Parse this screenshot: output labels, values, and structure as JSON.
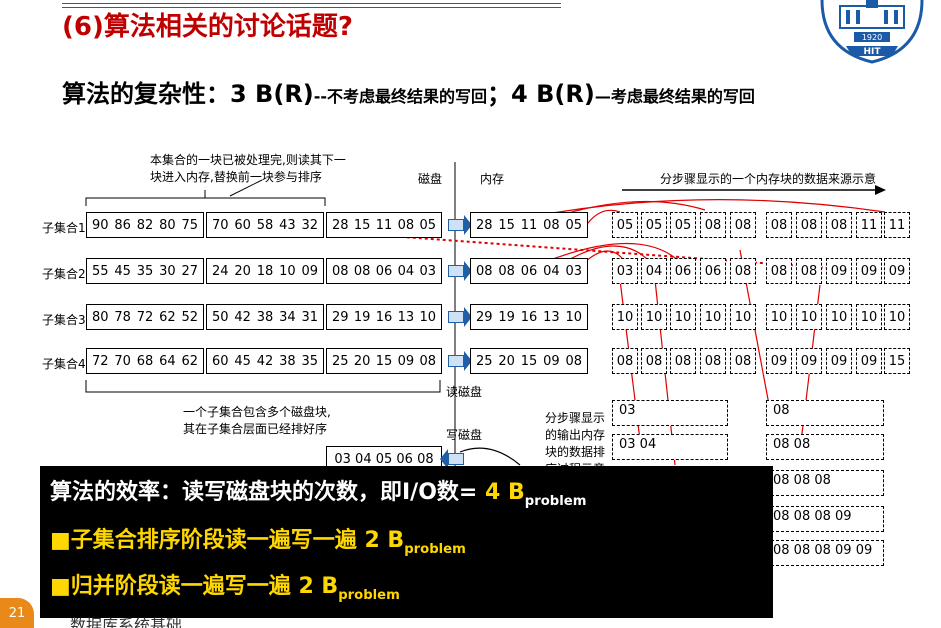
{
  "title": "(6)算法相关的讨论话题?",
  "subtitle": {
    "prefix": "算法的复杂性：3 B(R)",
    "note1": "--不考虑最终结果的写回",
    "mid": "；4 B(R)",
    "note2": "—考虑最终结果的写回"
  },
  "logo": {
    "year": "1920",
    "text": "HIT"
  },
  "diagram": {
    "note_top": [
      "本集合的一块已被处理完,则读其下一",
      "块进入内存,替换前一块参与排序"
    ],
    "label_disk": "磁盘",
    "label_mem": "内存",
    "label_steps": "分步骤显示的一个内存块的数据来源示意",
    "rows": [
      {
        "label": "子集合1",
        "b1": [
          "90",
          "86",
          "82",
          "80",
          "75"
        ],
        "b2": [
          "70",
          "60",
          "58",
          "43",
          "32"
        ],
        "b3": [
          "28",
          "15",
          "11",
          "08",
          "05"
        ],
        "mem": [
          "28",
          "15",
          "11",
          "08",
          "05"
        ],
        "steps": [
          "05",
          "05",
          "05",
          "08",
          "08",
          "08",
          "08",
          "08",
          "11",
          "11"
        ]
      },
      {
        "label": "子集合2",
        "b1": [
          "55",
          "45",
          "35",
          "30",
          "27"
        ],
        "b2": [
          "24",
          "20",
          "18",
          "10",
          "09"
        ],
        "b3": [
          "08",
          "08",
          "06",
          "04",
          "03"
        ],
        "mem": [
          "08",
          "08",
          "06",
          "04",
          "03"
        ],
        "steps": [
          "03",
          "04",
          "06",
          "06",
          "08",
          "08",
          "08",
          "09",
          "09",
          "09"
        ]
      },
      {
        "label": "子集合3",
        "b1": [
          "80",
          "78",
          "72",
          "62",
          "52"
        ],
        "b2": [
          "50",
          "42",
          "38",
          "34",
          "31"
        ],
        "b3": [
          "29",
          "19",
          "16",
          "13",
          "10"
        ],
        "mem": [
          "29",
          "19",
          "16",
          "13",
          "10"
        ],
        "steps": [
          "10",
          "10",
          "10",
          "10",
          "10",
          "10",
          "10",
          "10",
          "10",
          "10"
        ]
      },
      {
        "label": "子集合4",
        "b1": [
          "72",
          "70",
          "68",
          "64",
          "62"
        ],
        "b2": [
          "60",
          "45",
          "42",
          "38",
          "35"
        ],
        "b3": [
          "25",
          "20",
          "15",
          "09",
          "08"
        ],
        "mem": [
          "25",
          "20",
          "15",
          "09",
          "08"
        ],
        "steps": [
          "08",
          "08",
          "08",
          "08",
          "08",
          "09",
          "09",
          "09",
          "09",
          "15"
        ]
      }
    ],
    "label_read_disk": "读磁盘",
    "label_write_disk": "写磁盘",
    "note_bottom": [
      "一个子集合包含多个磁盘块,",
      "其在子集合层面已经排好序"
    ],
    "note_output": [
      "分步骤显示",
      "的输出内存",
      "块的数据排",
      "序过程示意"
    ],
    "write_block": "03 04 05 06 08",
    "output_left": [
      "03",
      "03  04"
    ],
    "output_right": [
      "08",
      "08  08",
      "08  08  08",
      "08  08  08  09",
      "08  08  08  09  09"
    ]
  },
  "overlay": {
    "line1_prefix": "算法的效率：读写磁盘块的次数，即I/O数=",
    "line1_value": "4 B",
    "line1_sub": "problem",
    "line2_prefix": "■子集合排序阶段读一遍写一遍",
    "line2_value": "2 B",
    "line2_sub": "problem",
    "line3_prefix": "■归并阶段读一遍写一遍",
    "line3_value": "2 B",
    "line3_sub": "problem"
  },
  "footer": {
    "page": "21",
    "course": "数据库系统基础"
  },
  "colors": {
    "title": "#c00000",
    "overlay_bg": "#000000",
    "overlay_yellow": "#ffd700",
    "arrow_red": "#e00000",
    "page_badge": "#e8891a"
  }
}
